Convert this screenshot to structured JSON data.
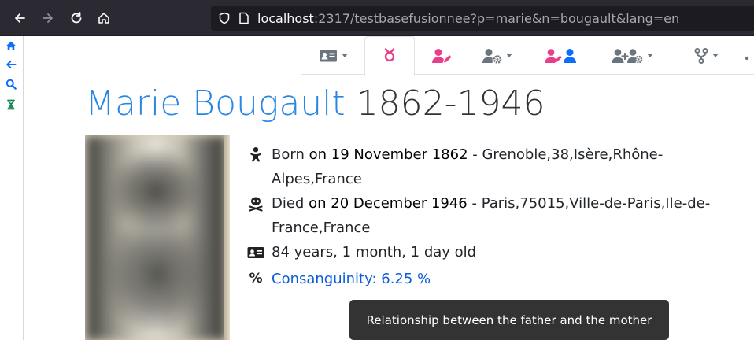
{
  "browser": {
    "url_host": "localhost",
    "url_rest": ":2317/testbasefusionnee?p=marie&n=bougault&lang=en",
    "icons": [
      "back-arrow-icon",
      "forward-arrow-icon",
      "reload-icon",
      "home-icon",
      "shield-icon",
      "page-icon"
    ]
  },
  "leftnav": {
    "items": [
      {
        "icon": "home-icon",
        "color": "#0d6efd"
      },
      {
        "icon": "arrow-left-icon",
        "color": "#0d6efd"
      },
      {
        "icon": "search-icon",
        "color": "#0d6efd"
      },
      {
        "icon": "hourglass-icon",
        "color": "#198754"
      }
    ]
  },
  "tabs": [
    {
      "icon": "id-card-icon",
      "has_caret": true,
      "active": false
    },
    {
      "icon": "female-symbol-icon",
      "has_caret": false,
      "active": true
    },
    {
      "icon": "user-edit-icon",
      "has_caret": false,
      "active": false
    },
    {
      "icon": "user-cog-icon",
      "has_caret": true,
      "active": false
    },
    {
      "icon": "users-edit-icon",
      "has_caret": false,
      "active": false
    },
    {
      "icon": "user-plus-cog-icon",
      "has_caret": true,
      "active": false
    },
    {
      "icon": "code-fork-icon",
      "has_caret": true,
      "active": false
    }
  ],
  "person": {
    "name": "Marie Bougault",
    "dates": "1862-1946",
    "portrait_alt": "blurred portrait photo",
    "born_label": "Born",
    "born_date": "on 19 November 1862",
    "born_place": " - Grenoble,38,Isère,Rhône-Alpes,France",
    "died_label": "Died",
    "died_date": "on 20 December 1946",
    "died_place": " - Paris,75015,Ville-de-Paris,Ile-de-France,France",
    "age": "84 years, 1 month, 1 day old",
    "consanguinity_symbol": "%",
    "consanguinity": "Consanguinity: 6.25 %"
  },
  "tooltip": {
    "text": "Relationship between the father and the mother"
  },
  "colors": {
    "name_blue": "#2b86e3",
    "pink": "#e83e8c",
    "link_blue": "#0b5ed7",
    "grey_icon": "#6c757d"
  }
}
